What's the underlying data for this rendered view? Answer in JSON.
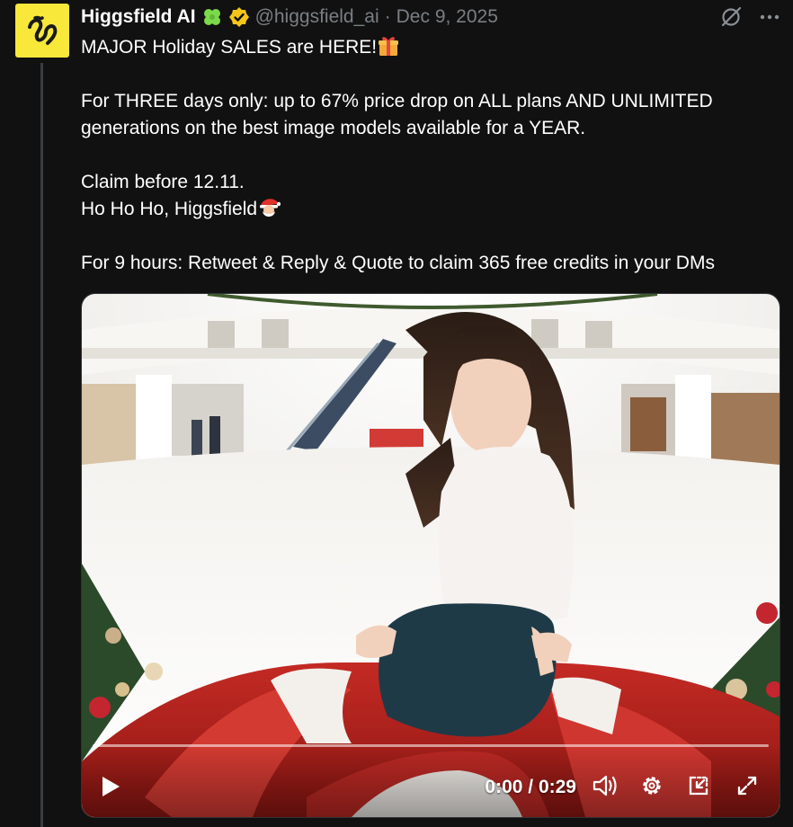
{
  "author": {
    "name": "Higgsfield AI",
    "handle": "@higgsfield_ai",
    "separator": "·",
    "date": "Dec 9, 2025",
    "avatar_icon": "higgsfield-logo",
    "badges": [
      "clover-icon",
      "verified-icon"
    ]
  },
  "tweet": {
    "line1": "MAJOR Holiday SALES are HERE!",
    "line1_emoji": "gift-icon",
    "line2": "For THREE days only: up to 67% price drop on ALL plans AND UNLIMITED generations on the best image models available for a YEAR.",
    "line3": "Claim before 12.11.",
    "line4": "Ho Ho Ho, Higgsfield",
    "line4_emoji": "santa-icon",
    "line5": "For 9 hours: Retweet & Reply & Quote to claim 365 free credits in your DMs"
  },
  "video": {
    "time": "0:00 / 0:29",
    "progress": 0.0,
    "controls": [
      "play-icon",
      "volume-icon",
      "settings-icon",
      "pip-icon",
      "fullscreen-icon"
    ]
  },
  "colors": {
    "background": "#111111",
    "avatar": "#f7e83a",
    "badge_gold": "#f5c518",
    "clover": "#7bd94c",
    "muted": "#7a7f84"
  }
}
